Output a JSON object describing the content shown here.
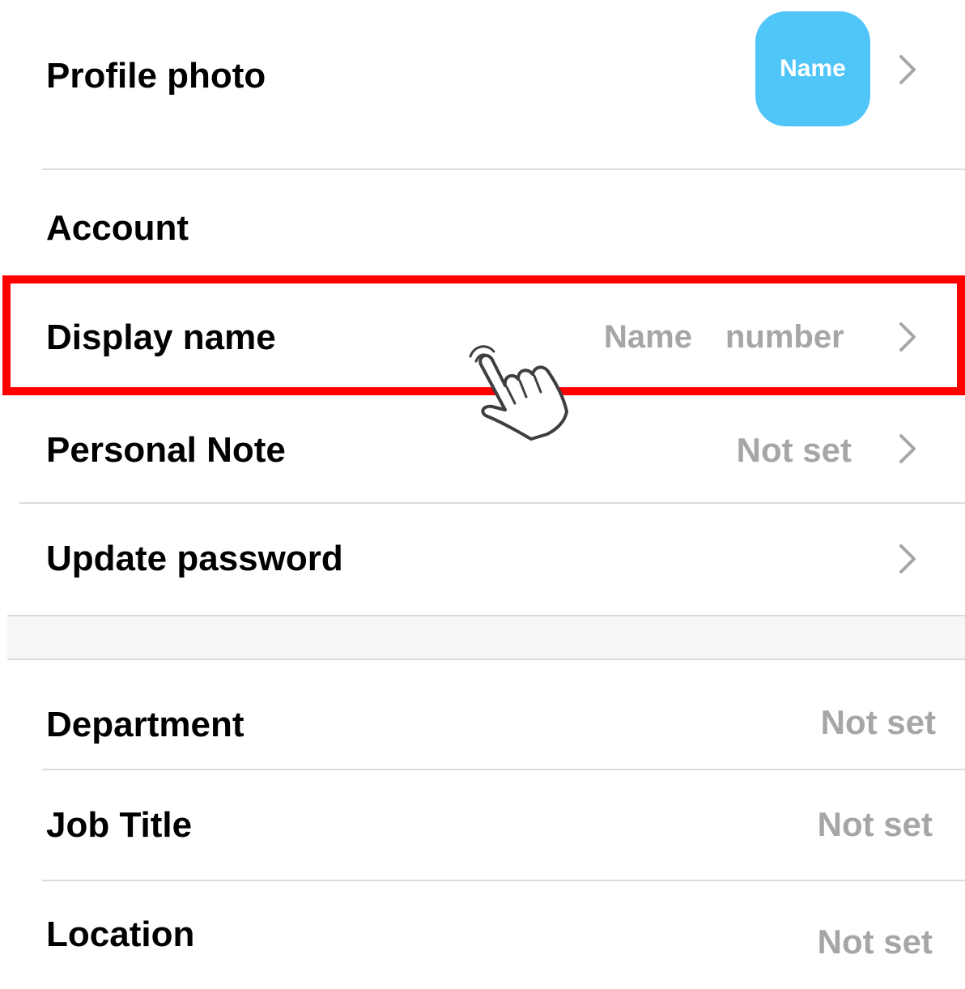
{
  "profile": {
    "photo_label": "Profile photo",
    "avatar_text": "Name",
    "avatar_color": "#4fc6f7"
  },
  "account": {
    "section_label": "Account",
    "display_name": {
      "label": "Display name",
      "value_name": "Name",
      "value_number": "number"
    },
    "personal_note": {
      "label": "Personal Note",
      "value": "Not set"
    },
    "update_password": {
      "label": "Update password"
    }
  },
  "details": {
    "department": {
      "label": "Department",
      "value": "Not set"
    },
    "job_title": {
      "label": "Job Title",
      "value": "Not set"
    },
    "location": {
      "label": "Location",
      "value": "Not set"
    }
  },
  "icons": {
    "chevron": "chevron-right-icon",
    "pointer": "tap-hand-icon"
  },
  "colors": {
    "highlight": "#ff0000",
    "muted_text": "#a6a6a6",
    "divider": "#dcdcdc"
  }
}
